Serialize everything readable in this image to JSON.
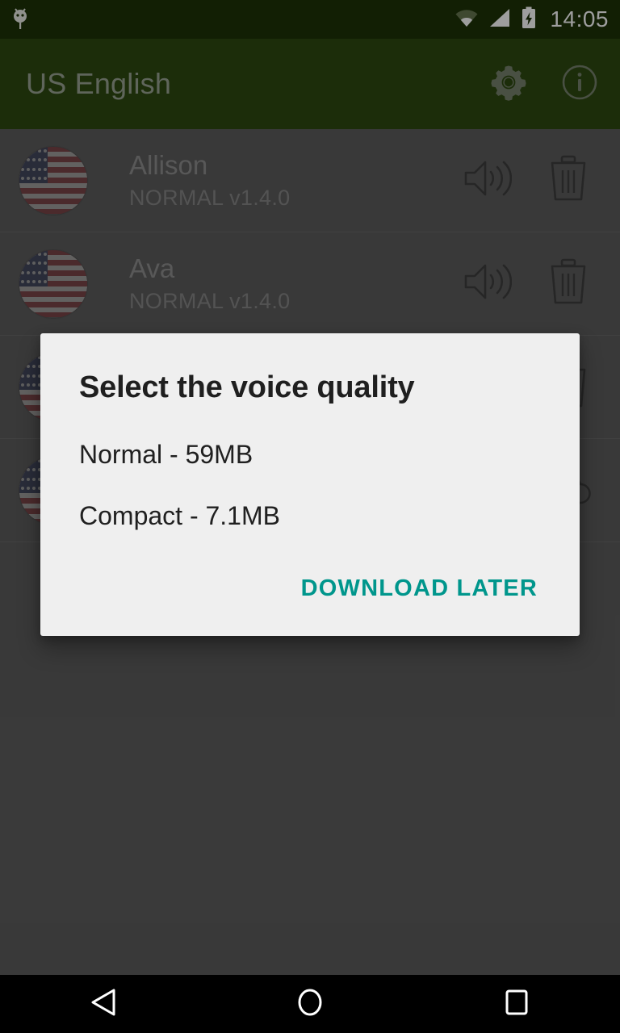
{
  "status_bar": {
    "time": "14:05",
    "icons": [
      "android-notification-icon",
      "wifi-icon",
      "cellular-signal-icon",
      "battery-charging-icon"
    ],
    "background_color": "#1d3208"
  },
  "toolbar": {
    "title": "US English",
    "background_color": "#2e4a11",
    "title_color": "#9aa393",
    "actions": [
      {
        "name": "settings-button",
        "icon": "gear-icon"
      },
      {
        "name": "info-button",
        "icon": "info-circle-icon"
      }
    ]
  },
  "voice_list": {
    "background_color": "#5d5d5d",
    "rows": [
      {
        "name": "Allison",
        "subtitle": "NORMAL v1.4.0",
        "avatar": "us-flag-icon",
        "actions": [
          "speaker-icon",
          "trash-icon"
        ]
      },
      {
        "name": "Ava",
        "subtitle": "NORMAL v1.4.0",
        "avatar": "us-flag-icon",
        "actions": [
          "speaker-icon",
          "trash-icon"
        ]
      },
      {
        "name": "",
        "subtitle": "",
        "avatar": "us-flag-icon",
        "actions": [
          "speaker-icon",
          "trash-icon"
        ]
      },
      {
        "name": "",
        "subtitle": "",
        "avatar": "us-flag-icon",
        "actions": [
          "speaker-icon",
          "cloud-download-icon"
        ]
      }
    ]
  },
  "dialog": {
    "title": "Select the voice quality",
    "background_color": "#efefef",
    "options": [
      {
        "label": "Normal - 59MB"
      },
      {
        "label": "Compact - 7.1MB"
      }
    ],
    "buttons": [
      {
        "label": "DOWNLOAD LATER",
        "color": "#00968c"
      }
    ]
  },
  "nav_bar": {
    "background_color": "#000000",
    "buttons": [
      {
        "name": "back-button",
        "icon": "triangle-back-icon"
      },
      {
        "name": "home-button",
        "icon": "circle-home-icon"
      },
      {
        "name": "recents-button",
        "icon": "square-recents-icon"
      }
    ]
  }
}
